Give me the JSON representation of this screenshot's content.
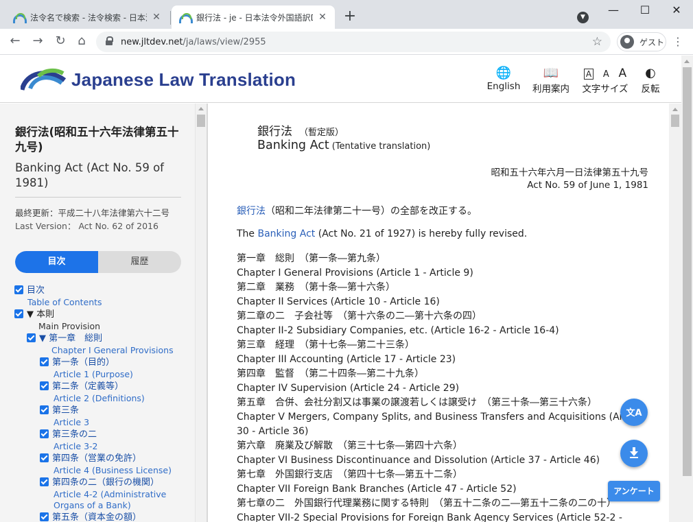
{
  "browser": {
    "tabs": [
      {
        "title": "法令名で検索 - 法令検索 - 日本法"
      },
      {
        "title": "銀行法 - je - 日本法令外国語訳DB"
      }
    ],
    "new_tab": "+",
    "url_host": "new.jltdev.net",
    "url_path": "/ja/laws/view/2955",
    "profile_label": "ゲスト"
  },
  "site": {
    "title": "Japanese Law Translation",
    "nav": {
      "english": "English",
      "guide": "利用案内",
      "font_size": "文字サイズ",
      "contrast": "反転"
    },
    "font_glyphs": [
      "A",
      "A",
      "A"
    ]
  },
  "sidebar": {
    "title_ja": "銀行法(昭和五十六年法律第五十九号)",
    "title_en": "Banking Act (Act No. 59 of 1981)",
    "last_update_ja": "最終更新：平成二十八年法律第六十二号",
    "last_update_en": "Last Version： Act No. 62 of 2016",
    "tabs": {
      "toc": "目次",
      "history": "履歴"
    },
    "toc": [
      {
        "ja": "目次",
        "en": "Table of Contents"
      },
      {
        "ja": "▼ 本則",
        "en": "Main Provision"
      },
      {
        "ja": "▼ 第一章　総則",
        "en": "Chapter I General Provisions"
      },
      {
        "ja": "第一条（目的）",
        "en": "Article 1 (Purpose)"
      },
      {
        "ja": "第二条（定義等）",
        "en": "Article 2 (Definitions)"
      },
      {
        "ja": "第三条",
        "en": "Article 3"
      },
      {
        "ja": "第三条の二",
        "en": "Article 3-2"
      },
      {
        "ja": "第四条（営業の免許）",
        "en": "Article 4 (Business License)"
      },
      {
        "ja": "第四条の二（銀行の機関）",
        "en": "Article 4-2 (Administrative",
        "en2": "Organs of a Bank)"
      },
      {
        "ja": "第五条（資本金の額）",
        "en": ""
      }
    ]
  },
  "main": {
    "title_ja": "銀行法",
    "title_ja_note": "（暫定版）",
    "title_en": "Banking Act",
    "title_en_note": "(Tentative translation)",
    "law_num_ja": "昭和五十六年六月一日法律第五十九号",
    "law_num_en": "Act No. 59 of June 1, 1981",
    "revision_ja_link": "銀行法",
    "revision_ja_rest": "（昭和二年法律第二十一号）の全部を改正する。",
    "revision_en_pre": "The ",
    "revision_en_link": "Banking Act",
    "revision_en_rest": " (Act No. 21 of 1927) is hereby fully revised.",
    "chapters": [
      "第一章　総則　（第一条―第九条）",
      "Chapter I General Provisions (Article 1 - Article 9)",
      "第二章　業務　（第十条―第十六条）",
      "Chapter II Services (Article 10 - Article 16)",
      "第二章の二　子会社等　（第十六条の二―第十六条の四）",
      "Chapter II-2 Subsidiary Companies, etc. (Article 16-2 - Article 16-4)",
      "第三章　経理　（第十七条―第二十三条）",
      "Chapter III Accounting (Article 17 - Article 23)",
      "第四章　監督　（第二十四条―第二十九条）",
      "Chapter IV Supervision (Article 24 - Article 29)",
      "第五章　合併、会社分割又は事業の譲渡若しくは譲受け　（第三十条―第三十六条）",
      "Chapter V Mergers, Company Splits, and Business Transfers and Acquisitions (Article",
      "30 - Article 36)",
      "第六章　廃業及び解散　（第三十七条―第四十六条）",
      "Chapter VI Business Discontinuance and Dissolution (Article 37 - Article 46)",
      "第七章　外国銀行支店　（第四十七条―第五十二条）",
      "Chapter VII Foreign Bank Branches (Article 47 - Article 52)",
      "第七章の二　外国銀行代理業務に関する特則　（第五十二条の二―第五十二条の二の十）",
      "Chapter VII-2 Special Provisions for Foreign Bank Agency Services (Article 52-2 -"
    ]
  },
  "floating": {
    "translate_icon": "文A",
    "survey": "アンケート"
  },
  "colors": {
    "brand_blue": "#2a3f8f",
    "link": "#2a5fb8",
    "accent": "#1d73e8"
  }
}
